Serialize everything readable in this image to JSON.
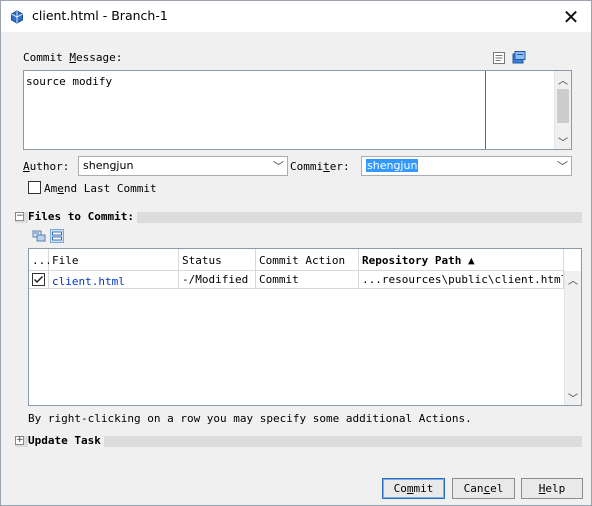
{
  "window": {
    "title": "client.html - Branch-1"
  },
  "commit_message": {
    "label_prefix": "Commit ",
    "label_mnemonic": "M",
    "label_suffix": "essage:",
    "value": "source modify"
  },
  "author": {
    "label_mnemonic": "A",
    "label_suffix": "uthor:",
    "value": "shengjun"
  },
  "committer": {
    "label_prefix": "Commi",
    "label_mnemonic": "t",
    "label_suffix": "er:",
    "value": "shengjun"
  },
  "amend": {
    "label_prefix": "Am",
    "label_mnemonic": "e",
    "label_suffix": "nd Last Commit",
    "checked": false
  },
  "files_section": {
    "title": "Files to Commit:",
    "columns": [
      "...",
      "File",
      "Status",
      "Commit Action",
      "Repository Path ▲"
    ],
    "rows": [
      {
        "checked": true,
        "file": "client.html",
        "status": "-/Modified",
        "action": "Commit",
        "path": "...resources\\public\\client.html"
      }
    ],
    "hint": "By right-clicking on a row you may specify some additional Actions."
  },
  "update_section": {
    "title": "Update Task"
  },
  "buttons": {
    "commit": {
      "prefix": "Co",
      "mnemonic": "m",
      "suffix": "mit"
    },
    "cancel": {
      "prefix": "Can",
      "mnemonic": "c",
      "suffix": "el"
    },
    "help": {
      "prefix": "",
      "mnemonic": "H",
      "suffix": "elp"
    }
  },
  "colors": {
    "selection": "#3399ff",
    "link": "#0033cc",
    "margin_line": "#e03030"
  }
}
